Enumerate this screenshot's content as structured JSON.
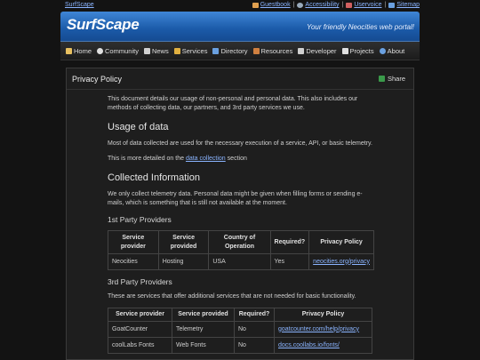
{
  "topbar": {
    "brand": "SurfScape",
    "links": [
      {
        "label": "Guestbook",
        "icon": "flag-icon",
        "color": "#e0a050"
      },
      {
        "label": "Accessibility",
        "icon": "globe-icon",
        "color": "#9ab"
      },
      {
        "label": "Uservoice",
        "icon": "pen-icon",
        "color": "#d06060"
      },
      {
        "label": "Sitemap",
        "icon": "sitemap-icon",
        "color": "#6aa0e0"
      }
    ],
    "separator": "|"
  },
  "banner": {
    "logo": "SurfScape",
    "tagline": "Your friendly Neocities web portal!"
  },
  "nav": [
    {
      "label": "Home",
      "icon": "home-icon",
      "color": "#e8c060"
    },
    {
      "label": "Community",
      "icon": "chat-icon",
      "color": "#e0e0e0"
    },
    {
      "label": "News",
      "icon": "newspaper-icon",
      "color": "#d0d0d0"
    },
    {
      "label": "Services",
      "icon": "services-icon",
      "color": "#e0b040"
    },
    {
      "label": "Directory",
      "icon": "folder-icon",
      "color": "#6aa0e0"
    },
    {
      "label": "Resources",
      "icon": "book-icon",
      "color": "#d08040"
    },
    {
      "label": "Developer",
      "icon": "code-icon",
      "color": "#d0d0d0"
    },
    {
      "label": "Projects",
      "icon": "projects-icon",
      "color": "#e0e0e0"
    },
    {
      "label": "About",
      "icon": "info-icon",
      "color": "#6aa0e0"
    }
  ],
  "page": {
    "title": "Privacy Policy",
    "share_label": "Share",
    "intro": "This document details our usage of non-personal and personal data. This also includes our methods of collecting data, our partners, and 3rd party services we use.",
    "usage_heading": "Usage of data",
    "usage_text": "Most of data collected are used for the necessary execution of a service, API, or basic telemetry.",
    "detail_prefix": "This is more detailed on the",
    "detail_link": "data collection",
    "detail_suffix": "section",
    "collected_heading": "Collected Information",
    "collected_text": "We only collect telemetry data. Personal data might be given when filling forms or sending e-mails, which is something that is still not available at the moment.",
    "first_party_heading": "1st Party Providers",
    "third_party_heading": "3rd Party Providers",
    "third_party_text": "These are services that offer additional services that are not needed for basic functionality."
  },
  "first_party_table": {
    "headers": [
      "Service provider",
      "Service provided",
      "Country of Operation",
      "Required?",
      "Privacy Policy"
    ],
    "rows": [
      [
        "Neocities",
        "Hosting",
        "USA",
        "Yes",
        "neocities.org/privacy"
      ]
    ]
  },
  "third_party_table": {
    "headers": [
      "Service provider",
      "Service provided",
      "Required?",
      "Privacy Policy"
    ],
    "rows": [
      [
        "GoatCounter",
        "Telemetry",
        "No",
        "goatcounter.com/help/privacy"
      ],
      [
        "coolLabs Fonts",
        "Web Fonts",
        "No",
        "docs.coollabs.io/fonts/"
      ]
    ]
  }
}
